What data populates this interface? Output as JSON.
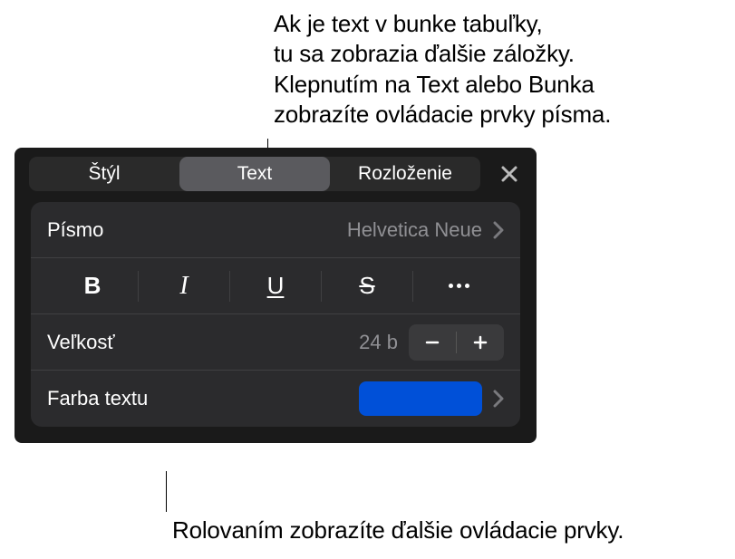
{
  "callouts": {
    "top": "Ak je text v bunke tabuľky,\ntu sa zobrazia ďalšie záložky.\nKlepnutím na Text alebo Bunka\nzobrazíte ovládacie prvky písma.",
    "bottom": "Rolovaním zobrazíte ďalšie ovládacie prvky."
  },
  "tabs": {
    "items": [
      {
        "label": "Štýl"
      },
      {
        "label": "Text"
      },
      {
        "label": "Rozloženie"
      }
    ]
  },
  "font": {
    "label": "Písmo",
    "value": "Helvetica Neue"
  },
  "formats": {
    "bold": "B",
    "italic": "I",
    "underline": "U",
    "strike": "S"
  },
  "size": {
    "label": "Veľkosť",
    "value": "24 b"
  },
  "color": {
    "label": "Farba textu",
    "value": "#0050d8"
  }
}
